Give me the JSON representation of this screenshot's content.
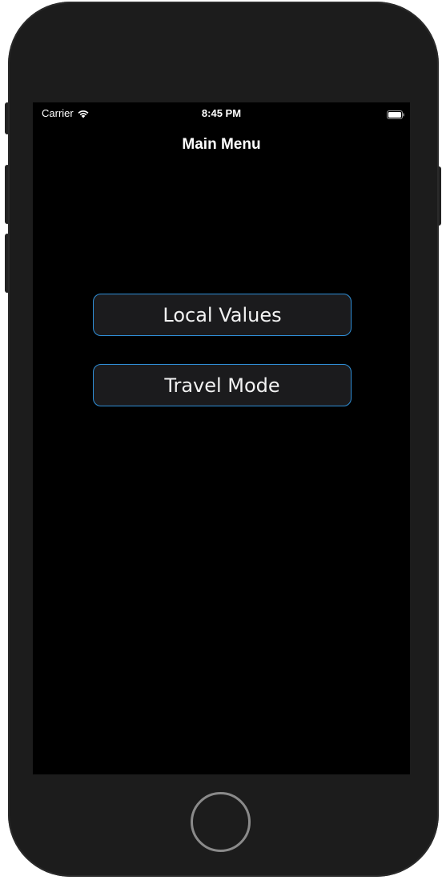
{
  "status_bar": {
    "carrier": "Carrier",
    "time": "8:45 PM",
    "wifi_icon": "wifi-icon",
    "battery_icon": "battery-icon"
  },
  "navigation": {
    "title": "Main Menu"
  },
  "menu": {
    "local_values_label": "Local Values",
    "travel_mode_label": "Travel Mode"
  },
  "colors": {
    "button_border": "#2f8fd8",
    "button_background": "#1b1b1d",
    "screen_background": "#000000",
    "device_body": "#1c1c1c"
  }
}
